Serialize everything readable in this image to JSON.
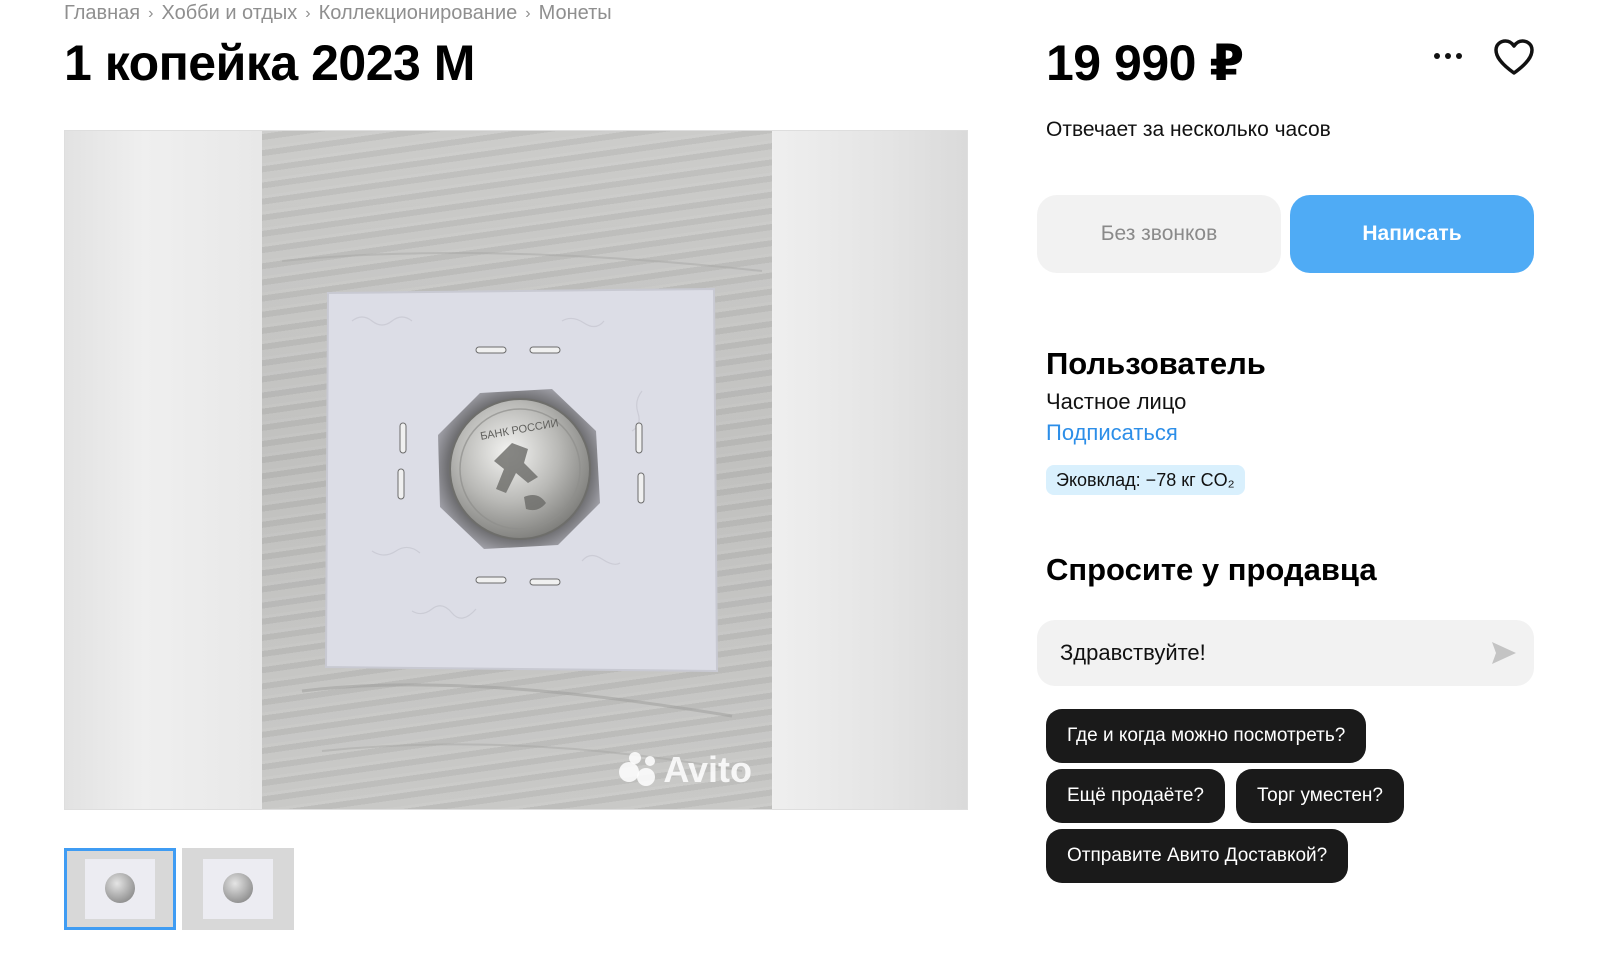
{
  "breadcrumb": [
    "Главная",
    "Хобби и отдых",
    "Коллекционирование",
    "Монеты"
  ],
  "listing": {
    "title": "1 копейка 2023 М",
    "price": "19 990 ₽",
    "response_time": "Отвечает за несколько часов"
  },
  "actions": {
    "no_calls_label": "Без звонков",
    "write_label": "Написать"
  },
  "gallery": {
    "watermark": "Avito",
    "thumbnail_count": 2,
    "active_index": 0
  },
  "seller": {
    "name": "Пользователь",
    "type": "Частное лицо",
    "subscribe_label": "Подписаться",
    "eco_badge": "Эковклад: −78 кг CO₂"
  },
  "ask": {
    "title": "Спросите у продавца",
    "message_value": "Здравствуйте!",
    "quick_questions": [
      "Где и когда можно посмотреть?",
      "Ещё продаёте?",
      "Торг уместен?",
      "Отправите Авито Доставкой?"
    ]
  },
  "icons": {
    "more": "more-horizontal-icon",
    "favorite": "heart-icon",
    "send": "send-icon",
    "breadcrumb_separator": "chevron-right-icon"
  },
  "colors": {
    "accent": "#4fabf5",
    "link": "#2c8ee8",
    "chip_bg": "#1a1a1a",
    "eco_badge_bg": "#d9f0fd"
  }
}
